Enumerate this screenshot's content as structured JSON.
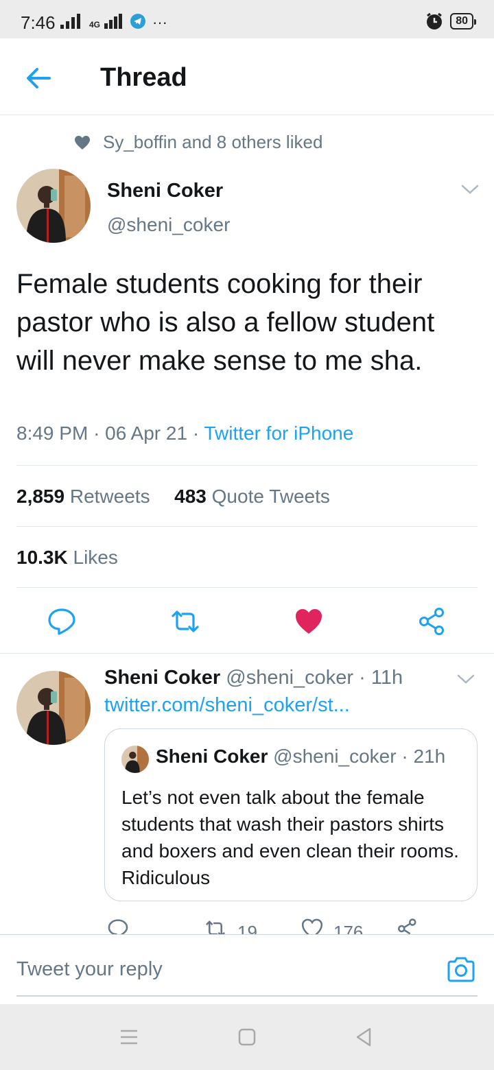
{
  "status_bar": {
    "time": "7:46",
    "network_label": "4G",
    "more": "···",
    "battery": "80"
  },
  "header": {
    "title": "Thread"
  },
  "social_context": {
    "text": "Sy_boffin and 8 others liked"
  },
  "main_tweet": {
    "author_name": "Sheni Coker",
    "author_handle": "@sheni_coker",
    "text": "Female students cooking for their pastor who is also a fellow student will never make sense to me sha.",
    "time": "8:49 PM",
    "date": "06 Apr 21",
    "source": "Twitter for iPhone",
    "retweets_count": "2,859",
    "retweets_label": "Retweets",
    "quotes_count": "483",
    "quotes_label": "Quote Tweets",
    "likes_count": "10.3K",
    "likes_label": "Likes",
    "liked": true
  },
  "reply_tweet": {
    "author_name": "Sheni Coker",
    "author_handle": "@sheni_coker",
    "age": "11h",
    "link": "twitter.com/sheni_coker/st...",
    "quoted": {
      "author_name": "Sheni Coker",
      "author_handle": "@sheni_coker",
      "age": "21h",
      "text": "Let’s not even talk about the female students that wash their pastors shirts and boxers and even clean their rooms. Ridiculous"
    },
    "retweets": "19",
    "likes": "176"
  },
  "composer": {
    "placeholder": "Tweet your reply"
  },
  "colors": {
    "accent": "#1da1f2",
    "like": "#e0245e",
    "muted": "#657786",
    "text": "#14171a"
  }
}
